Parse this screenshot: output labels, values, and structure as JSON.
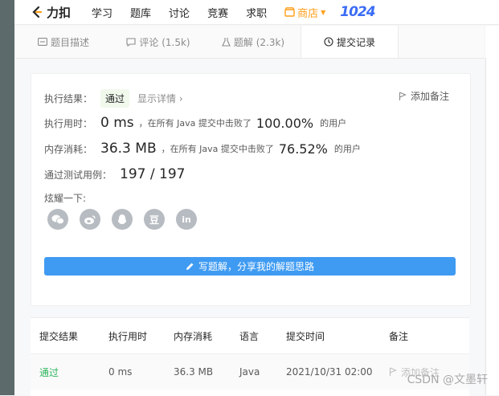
{
  "topbar": {
    "logo_text": "力扣",
    "nav": [
      "学习",
      "题库",
      "讨论",
      "竞赛",
      "求职"
    ],
    "shop": "商店",
    "promo": "1024"
  },
  "tabs": [
    {
      "label": "题目描述",
      "icon": "description-icon"
    },
    {
      "label": "评论 (1.5k)",
      "icon": "comment-icon"
    },
    {
      "label": "题解 (2.3k)",
      "icon": "flask-icon"
    },
    {
      "label": "提交记录",
      "icon": "clock-icon"
    }
  ],
  "result": {
    "label": "执行结果：",
    "status": "通过",
    "details": "显示详情 ›",
    "add_note": "添加备注",
    "runtime_label": "执行用时：",
    "runtime_value": "0 ms",
    "runtime_text": "，在所有 Java 提交中击败了",
    "runtime_pct": "100.00%",
    "runtime_suffix": "的用户",
    "memory_label": "内存消耗：",
    "memory_value": "36.3 MB",
    "memory_text": "，在所有 Java 提交中击败了",
    "memory_pct": "76.52%",
    "memory_suffix": "的用户",
    "tests_label": "通过测试用例：",
    "tests_value": "197 / 197",
    "share_label": "炫耀一下:",
    "share_icons": [
      "wechat-icon",
      "weibo-icon",
      "qq-icon",
      "douban-icon",
      "linkedin-icon"
    ],
    "douban_glyph": "豆",
    "linkedin_glyph": "in",
    "write_button": "写题解，分享我的解题思路"
  },
  "table": {
    "headers": [
      "提交结果",
      "执行用时",
      "内存消耗",
      "语言",
      "提交时间",
      "备注"
    ],
    "rows": [
      [
        "通过",
        "0 ms",
        "36.3 MB",
        "Java",
        "2021/10/31 02:00",
        "添加备注"
      ]
    ]
  },
  "watermark": "CSDN @文墨轩",
  "colors": {
    "accent": "#3f9bf2",
    "success": "#2db55d",
    "shop": "#ff9f1a"
  }
}
